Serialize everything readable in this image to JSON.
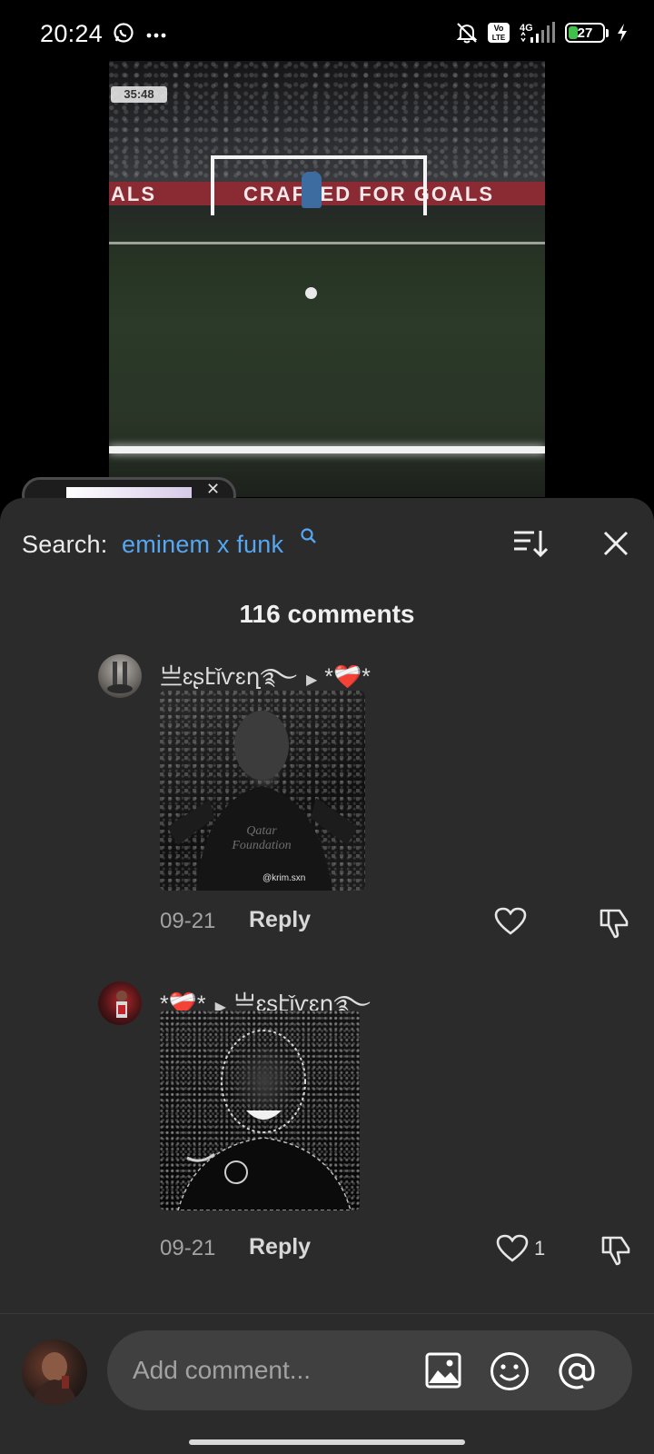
{
  "status_bar": {
    "time": "20:24",
    "battery_level": "27",
    "network": "4G",
    "volte": "Vo LTE",
    "icons": [
      "whatsapp-icon",
      "more-dots-icon",
      "bell-off-icon",
      "volte-icon",
      "signal-icon",
      "battery-icon",
      "charging-icon"
    ]
  },
  "video": {
    "timer": "35:48",
    "board_text_left": "ALS",
    "board_text_main": "CRAFTED FOR GOALS"
  },
  "comments_sheet": {
    "search_label": "Search:",
    "search_query": "eminem x funk",
    "comments_count": "116 comments",
    "comments": [
      {
        "author": "亗ɛʂէǐѵɛղ࿐",
        "reply_to": "*❤️‍🩹*",
        "date": "09-21",
        "reply_label": "Reply",
        "likes": "",
        "image_watermark": "@krim.sxn"
      },
      {
        "author": "*❤️‍🩹*",
        "reply_to": "亗ɛʂէǐѵɛղ࿐",
        "date": "09-21",
        "reply_label": "Reply",
        "likes": "1"
      }
    ]
  },
  "composer": {
    "placeholder": "Add comment..."
  },
  "colors": {
    "sheet_background": "#2b2b2c",
    "search_query": "#56a6f0",
    "input_background": "#404041"
  }
}
